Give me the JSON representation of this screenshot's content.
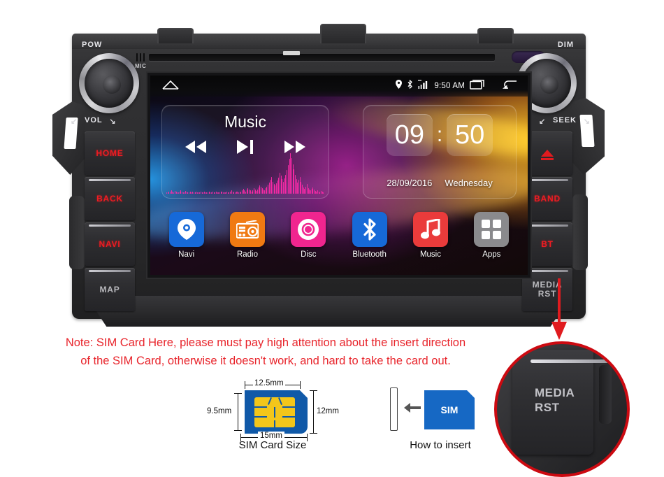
{
  "device": {
    "labels": {
      "pow": "POW",
      "vol": "VOL",
      "dim": "DIM",
      "seek": "SEEK",
      "mic": "MIC"
    },
    "left_buttons": [
      {
        "label": "HOME",
        "style": "red"
      },
      {
        "label": "BACK",
        "style": "red"
      },
      {
        "label": "NAVI",
        "style": "red"
      },
      {
        "label": "MAP",
        "style": "gray"
      }
    ],
    "right_buttons": [
      {
        "label": "",
        "icon": "eject-icon",
        "style": "red"
      },
      {
        "label": "BAND",
        "style": "red"
      },
      {
        "label": "BT",
        "style": "red"
      },
      {
        "label": "MEDIA RST",
        "line1": "MEDIA",
        "line2": "RST",
        "style": "gray"
      }
    ]
  },
  "screen": {
    "statusbar": {
      "home_icon": "home-icon",
      "location_icon": "location-pin-icon",
      "bluetooth_icon": "bluetooth-icon",
      "signal_icon": "signal-bars-icon",
      "time": "9:50 AM",
      "recents_icon": "recent-apps-icon",
      "back_icon": "back-arrow-icon"
    },
    "music_widget": {
      "title": "Music",
      "prev_icon": "rewind-icon",
      "play_icon": "play-pause-icon",
      "next_icon": "fast-forward-icon",
      "equalizer_color": "#ff29a8",
      "eq_bars": [
        4,
        3,
        6,
        5,
        9,
        6,
        4,
        7,
        5,
        3,
        4,
        6,
        8,
        5,
        3,
        4,
        7,
        5,
        4,
        3,
        5,
        4,
        6,
        4,
        3,
        5,
        4,
        3,
        4,
        6,
        4,
        3,
        5,
        4,
        3,
        4,
        5,
        3,
        4,
        6,
        4,
        3,
        5,
        4,
        3,
        4,
        6,
        5,
        4,
        3,
        4,
        5,
        3,
        4,
        6,
        8,
        5,
        4,
        3,
        5,
        6,
        4,
        3,
        5,
        8,
        12,
        9,
        6,
        10,
        14,
        11,
        8,
        6,
        9,
        13,
        10,
        7,
        11,
        16,
        20,
        18,
        14,
        11,
        9,
        13,
        17,
        22,
        28,
        34,
        42,
        30,
        24,
        20,
        26,
        33,
        40,
        52,
        44,
        36,
        30,
        38,
        47,
        58,
        70,
        86,
        100,
        88,
        72,
        60,
        46,
        36,
        28,
        34,
        42,
        30,
        22,
        16,
        12,
        18,
        24,
        14,
        10,
        8,
        12,
        16,
        10,
        7,
        5,
        9,
        6,
        4,
        7,
        5,
        3
      ]
    },
    "clock_widget": {
      "hours": "09",
      "colon": ":",
      "minutes": "50",
      "date": "28/09/2016",
      "weekday": "Wednesday"
    },
    "dock": [
      {
        "label": "Navi",
        "icon": "location-pin-icon",
        "color": "#1669d8"
      },
      {
        "label": "Radio",
        "icon": "radio-icon",
        "color": "#f07a12"
      },
      {
        "label": "Disc",
        "icon": "disc-icon",
        "color": "#f0258f"
      },
      {
        "label": "Bluetooth",
        "icon": "bluetooth-icon",
        "color": "#1669d8"
      },
      {
        "label": "Music",
        "icon": "music-note-icon",
        "color": "#ea3b3b"
      },
      {
        "label": "Apps",
        "icon": "apps-grid-icon",
        "color": "#8a8a8d"
      }
    ]
  },
  "note": {
    "line1": "Note: SIM Card Here, please must pay high attention about the insert direction",
    "line2": "of the SIM Card, otherwise it doesn't work, and hard to take the card out.",
    "color": "#e8242b"
  },
  "sim_diagram": {
    "caption": "SIM Card Size",
    "dim_top": "12.5mm",
    "dim_bottom": "15mm",
    "dim_left": "9.5mm",
    "dim_right": "12mm"
  },
  "how_to_insert": {
    "caption": "How to insert",
    "card_label": "SIM",
    "arrow_icon": "left-arrow-icon",
    "slot_icon": "card-slot-icon"
  },
  "magnifier": {
    "button_line1": "MEDIA",
    "button_line2": "RST",
    "ring_color": "#cc0a11",
    "pointer_icon": "down-arrow-icon"
  }
}
